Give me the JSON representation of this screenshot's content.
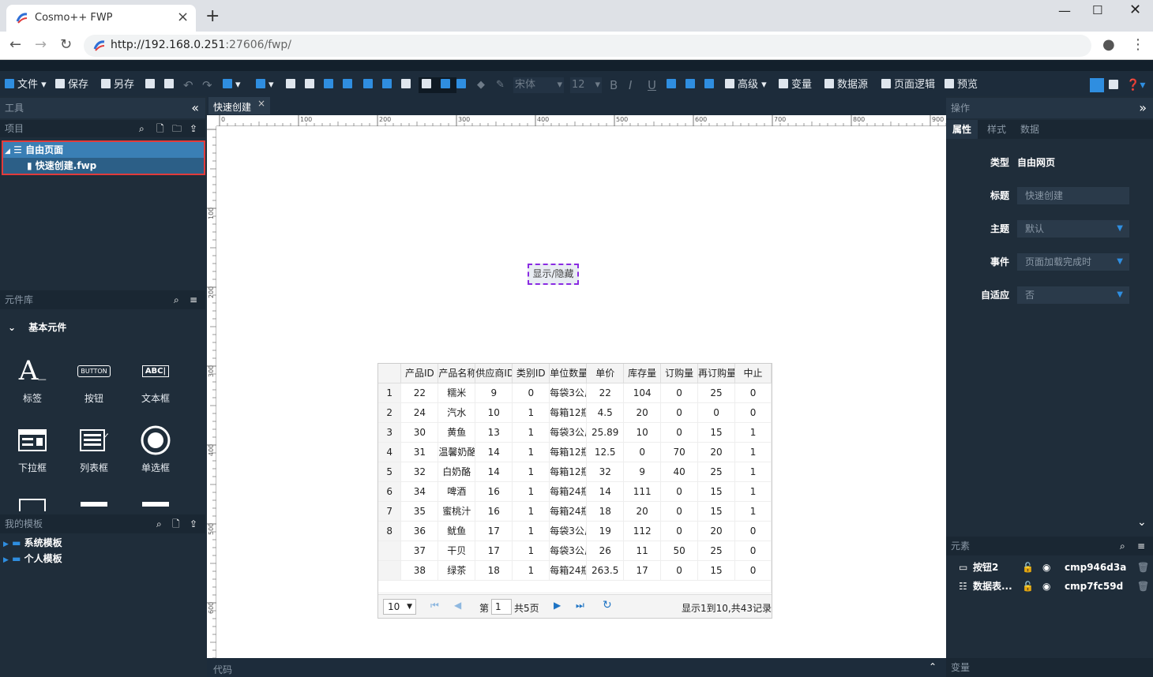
{
  "browser": {
    "tab_title": "Cosmo++ FWP",
    "url_host": "http://192.168.0.251",
    "url_rest": ":27606/fwp/"
  },
  "toolbar": {
    "file": "文件",
    "save": "保存",
    "save_as": "另存",
    "font_name": "宋体",
    "font_size": "12",
    "bold": "B",
    "italic": "I",
    "underline": "U",
    "advanced": "高级",
    "variables": "变量",
    "datasource": "数据源",
    "page_logic": "页面逻辑",
    "preview": "预览"
  },
  "left": {
    "tools_title": "工具",
    "project_title": "项目",
    "tree_root": "自由页面",
    "tree_child": "快速创建.fwp",
    "library_title": "元件库",
    "basic_components": "基本元件",
    "components": [
      {
        "label": "标签",
        "icon": "label-icon"
      },
      {
        "label": "按钮",
        "icon": "button-icon"
      },
      {
        "label": "文本框",
        "icon": "textbox-icon"
      },
      {
        "label": "下拉框",
        "icon": "dropdown-icon"
      },
      {
        "label": "列表框",
        "icon": "listbox-icon"
      },
      {
        "label": "单选框",
        "icon": "radio-icon"
      }
    ],
    "templates_title": "我的模板",
    "system_templates": "系统模板",
    "personal_templates": "个人模板"
  },
  "editor": {
    "doc_tab": "快速创建",
    "ruler_h": [
      "0",
      "100",
      "200",
      "300",
      "400",
      "500",
      "600",
      "700",
      "800",
      "900"
    ],
    "ruler_v": [
      "100",
      "200",
      "300",
      "400",
      "500",
      "600"
    ],
    "toggle_button": "显示/隐藏",
    "code_title": "代码"
  },
  "grid": {
    "columns": [
      "产品ID",
      "产品名称",
      "供应商ID",
      "类别ID",
      "单位数量",
      "单价",
      "库存量",
      "订购量",
      "再订购量",
      "中止"
    ],
    "row_numbers": [
      "1",
      "2",
      "3",
      "4",
      "5",
      "6",
      "7",
      "8"
    ],
    "rows": [
      [
        "22",
        "糯米",
        "9",
        "0",
        "每袋3公斤",
        "22",
        "104",
        "0",
        "25",
        "0"
      ],
      [
        "24",
        "汽水",
        "10",
        "1",
        "每箱12瓶",
        "4.5",
        "20",
        "0",
        "0",
        "0"
      ],
      [
        "30",
        "黄鱼",
        "13",
        "1",
        "每袋3公斤",
        "25.89",
        "10",
        "0",
        "15",
        "1"
      ],
      [
        "31",
        "温馨奶酪",
        "14",
        "1",
        "每箱12瓶",
        "12.5",
        "0",
        "70",
        "20",
        "1"
      ],
      [
        "32",
        "白奶酪",
        "14",
        "1",
        "每箱12瓶",
        "32",
        "9",
        "40",
        "25",
        "1"
      ],
      [
        "34",
        "啤酒",
        "16",
        "1",
        "每箱24瓶",
        "14",
        "111",
        "0",
        "15",
        "1"
      ],
      [
        "35",
        "蜜桃汁",
        "16",
        "1",
        "每箱24瓶",
        "18",
        "20",
        "0",
        "15",
        "1"
      ],
      [
        "36",
        "鱿鱼",
        "17",
        "1",
        "每袋3公斤",
        "19",
        "112",
        "0",
        "20",
        "0"
      ],
      [
        "37",
        "干贝",
        "17",
        "1",
        "每袋3公斤",
        "26",
        "11",
        "50",
        "25",
        "0"
      ],
      [
        "38",
        "绿茶",
        "18",
        "1",
        "每箱24瓶",
        "263.5",
        "17",
        "0",
        "15",
        "0"
      ]
    ],
    "page_size": "10",
    "page_prefix": "第",
    "page_value": "1",
    "page_total": "共5页",
    "summary": "显示1到10,共43记录"
  },
  "right": {
    "ops_title": "操作",
    "tabs": [
      "属性",
      "样式",
      "数据"
    ],
    "props": {
      "type_label": "类型",
      "type_value": "自由网页",
      "title_label": "标题",
      "title_value": "快速创建",
      "theme_label": "主题",
      "theme_value": "默认",
      "event_label": "事件",
      "event_value": "页面加载完成时",
      "adaptive_label": "自适应",
      "adaptive_value": "否"
    },
    "elements_title": "元素",
    "elements": [
      {
        "name": "按钮2",
        "id": "cmp946d3a",
        "icon": "button-element-icon"
      },
      {
        "name": "数据表...",
        "id": "cmp7fc59d",
        "icon": "table-element-icon"
      }
    ],
    "variables_title": "变量"
  }
}
